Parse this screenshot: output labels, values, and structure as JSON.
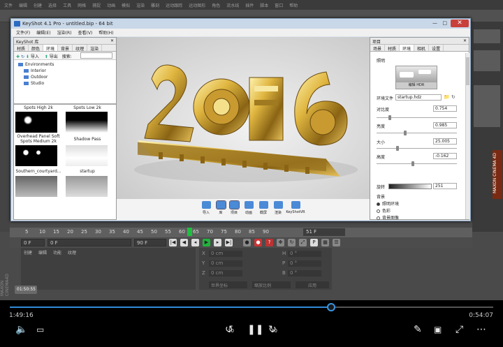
{
  "c4d": {
    "menu": [
      "文件",
      "编辑",
      "创建",
      "选择",
      "工具",
      "网格",
      "捕捉",
      "动画",
      "模拟",
      "渲染",
      "雕刻",
      "运动跟踪",
      "运动图形",
      "角色",
      "流水线",
      "插件",
      "脚本",
      "窗口",
      "帮助"
    ],
    "layout_label": "界面",
    "layout_value": "startup",
    "brand": "MAXON CINEMA 4D",
    "timeline_ticks": [
      "5",
      "10",
      "15",
      "20",
      "25",
      "30",
      "35",
      "40",
      "45",
      "50",
      "55",
      "60",
      "65",
      "70",
      "75",
      "80",
      "85",
      "90"
    ],
    "current_frame_tick": "51",
    "frame_display": "51 F",
    "fields": [
      "0 F",
      "0 F",
      "90 F",
      "90 F"
    ],
    "mat_tabs": [
      "创建",
      "编辑",
      "功能",
      "纹理"
    ],
    "coords": {
      "x": "0 cm",
      "y": "0 cm",
      "z": "0 cm",
      "h": "0 °",
      "p": "0 °",
      "b": "0 °"
    },
    "coord_system": "世界坐标",
    "scale_mode": "缩放比例",
    "apply": "应用"
  },
  "keyshot": {
    "title": "KeyShot 4.1 Pro - untitled.bip - 64 bit",
    "menu": [
      "文件(F)",
      "编辑(E)",
      "渲染(R)",
      "查看(V)",
      "帮助(H)"
    ],
    "library": {
      "panel_title": "KeyShot 库",
      "tabs": [
        "材质",
        "颜色",
        "环境",
        "背景",
        "纹理",
        "渲染"
      ],
      "active_tab": "环境",
      "import": "导入",
      "export": "导出",
      "search_label": "搜索:",
      "tree_root": "Environments",
      "tree_children": [
        "Interior",
        "Outdoor",
        "Studio"
      ],
      "thumbs": [
        {
          "label": "Spots High 2k"
        },
        {
          "label": "Spots Low 2k"
        },
        {
          "label": "Overhead Panel Soft Spots Medium 2k"
        },
        {
          "label": "Shadow Pass"
        },
        {
          "label": "Southern_courtyard..."
        },
        {
          "label": "startup"
        }
      ]
    },
    "bottom_buttons": [
      "导入",
      "库",
      "项目",
      "动画",
      "截屏",
      "渲染",
      "KeyShotVR"
    ],
    "project": {
      "panel_title": "项目",
      "tabs": [
        "场景",
        "材质",
        "环境",
        "相机",
        "设置"
      ],
      "active_tab": "环境",
      "section_lighting": "照明",
      "edit_hdr": "编辑 HDR",
      "env_file_label": "环境文件",
      "env_file_value": "startup.hdz",
      "contrast_label": "对比度",
      "contrast_value": "0.754",
      "brightness_label": "亮度",
      "brightness_value": "0.985",
      "size_label": "大小",
      "size_value": "25.005",
      "height_label": "高度",
      "height_value": "-0.162",
      "rotation_label": "旋转",
      "rotation_value": "251",
      "background_label": "背景",
      "radios": [
        "照明环境",
        "色彩",
        "背景图像"
      ],
      "selected_radio": 0,
      "sliders": {
        "contrast": 0.15,
        "brightness": 0.35,
        "size": 0.25,
        "height": 0.45
      }
    }
  },
  "player": {
    "elapsed": "1:49:16",
    "total": "0:54:07",
    "progress": 0.665,
    "skip_back": "10",
    "skip_fwd": "30",
    "badge": "01:50:55"
  }
}
